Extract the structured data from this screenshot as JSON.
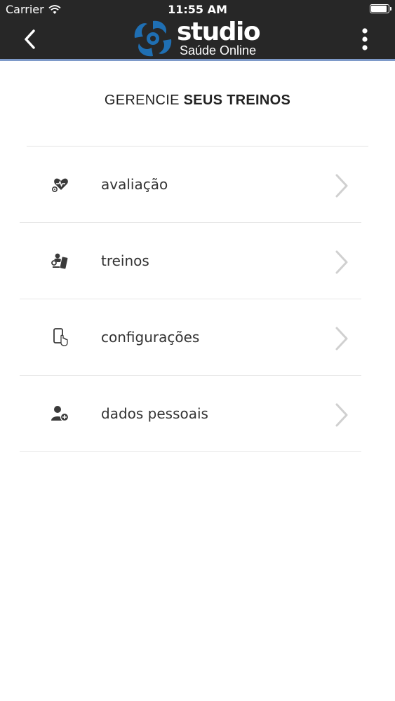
{
  "status_bar": {
    "carrier": "Carrier",
    "time": "11:55 AM",
    "battery_level": 1.0
  },
  "nav": {
    "back_icon": "chevron-left-icon",
    "menu_icon": "more-vertical-icon",
    "logo": {
      "main": "studio",
      "sub": "Saúde Online",
      "brand_color": "#1f6fb3"
    }
  },
  "page": {
    "heading_light": "GERENCIE ",
    "heading_bold": "SEUS TREINOS"
  },
  "menu": {
    "items": [
      {
        "label": "avaliação",
        "icon": "heart-stethoscope-icon"
      },
      {
        "label": "treinos",
        "icon": "weightlifting-icon"
      },
      {
        "label": "configurações",
        "icon": "mobile-touch-icon"
      },
      {
        "label": "dados pessoais",
        "icon": "add-user-icon"
      }
    ]
  },
  "colors": {
    "header_bg": "#272727",
    "accent_line": "#7e9ac9",
    "divider": "#e6e6e6",
    "chevron": "#d0d0d0",
    "icon": "#3a3a3a"
  }
}
